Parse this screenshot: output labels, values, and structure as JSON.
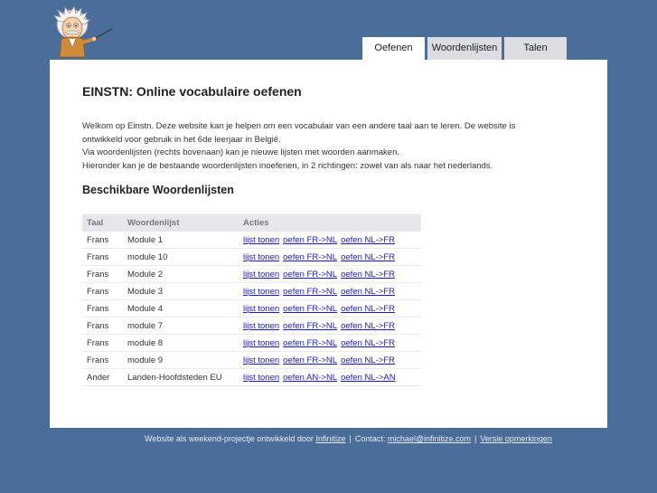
{
  "brand": {
    "mascot_icon": "einstein-mascot-icon"
  },
  "tabs": [
    {
      "label": "Oefenen",
      "active": true
    },
    {
      "label": "Woordenlijsten",
      "active": false
    },
    {
      "label": "Talen",
      "active": false
    }
  ],
  "main": {
    "title": "EINSTN: Online vocabulaire oefenen",
    "intro": [
      "Welkom op Einstn. Deze website kan je helpen om een vocabulair van een andere taal aan te leren. De website is",
      "ontwikkeld voor gebruik in het 6de leerjaar in België.",
      "Via woordenlijsten (rechts bovenaan) kan je nieuwe lijsten met woorden aanmaken.",
      "Hieronder kan je de bestaande woordenlijsten inoefenen, in 2 richtingen: zowel van als naar het nederlands."
    ],
    "subtitle": "Beschikbare Woordenlijsten",
    "table": {
      "headers": [
        "Taal",
        "Woordenlijst",
        "Acties"
      ],
      "rows": [
        {
          "taal": "Frans",
          "lijst": "Module 1",
          "actions": [
            "lijst tonen",
            "oefen FR->NL",
            "oefen NL->FR"
          ]
        },
        {
          "taal": "Frans",
          "lijst": "module 10",
          "actions": [
            "lijst tonen",
            "oefen FR->NL",
            "oefen NL->FR"
          ]
        },
        {
          "taal": "Frans",
          "lijst": "Module 2",
          "actions": [
            "lijst tonen",
            "oefen FR->NL",
            "oefen NL->FR"
          ]
        },
        {
          "taal": "Frans",
          "lijst": "Module 3",
          "actions": [
            "lijst tonen",
            "oefen FR->NL",
            "oefen NL->FR"
          ]
        },
        {
          "taal": "Frans",
          "lijst": "Module 4",
          "actions": [
            "lijst tonen",
            "oefen FR->NL",
            "oefen NL->FR"
          ]
        },
        {
          "taal": "Frans",
          "lijst": "module 7",
          "actions": [
            "lijst tonen",
            "oefen FR->NL",
            "oefen NL->FR"
          ]
        },
        {
          "taal": "Frans",
          "lijst": "module 8",
          "actions": [
            "lijst tonen",
            "oefen FR->NL",
            "oefen NL->FR"
          ]
        },
        {
          "taal": "Frans",
          "lijst": "module 9",
          "actions": [
            "lijst tonen",
            "oefen FR->NL",
            "oefen NL->FR"
          ]
        },
        {
          "taal": "Ander",
          "lijst": "Landen-Hoofdsteden EU",
          "actions": [
            "lijst tonen",
            "oefen AN->NL",
            "oefen NL->AN"
          ]
        }
      ]
    }
  },
  "footer": {
    "prefix": "Website als weekend-projectje ontwikkeld door",
    "company_link": "Infinitize",
    "contact_label": "Contact:",
    "email_link": "michael@infinitize.com",
    "remarks_link": "Versie opmerkingen",
    "separator": "|"
  },
  "colors": {
    "background": "#4a6d9a",
    "panel": "#ffffff",
    "tab_inactive": "#dcdde3",
    "link": "#1a1ad6",
    "table_header": "#e6e7ec"
  }
}
